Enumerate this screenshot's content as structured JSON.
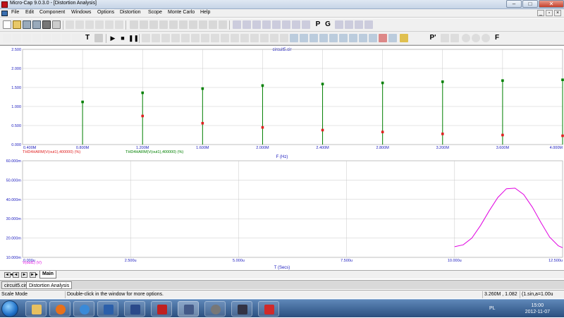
{
  "window": {
    "title": "Micro-Cap 9.0.3.0 - [Distortion Analysis]",
    "controls": {
      "minimize": "–",
      "maximize": "□",
      "close": "✕"
    }
  },
  "menubar": {
    "items": [
      "File",
      "Edit",
      "Component",
      "Windows",
      "Options",
      "Distortion",
      "Scope",
      "Monte Carlo",
      "Help"
    ],
    "mdi_controls": {
      "minimize": "_",
      "restore": "▫",
      "close": "×"
    }
  },
  "toolbar_text_buttons": {
    "text_tool": "T",
    "probe_p": "P",
    "probe_g": "G",
    "P_prime": "P'",
    "F_tool": "F"
  },
  "plot": {
    "circuit_title": "circuit5.cir",
    "top": {
      "ylim": [
        0,
        2.5
      ],
      "y_ticks": [
        "2.500",
        "2.000",
        "1.500",
        "1.000",
        "0.500",
        "0.000"
      ],
      "x_ticks": [
        "0.400M",
        "0.800M",
        "1.200M",
        "1.600M",
        "2.000M",
        "2.400M",
        "2.800M",
        "3.200M",
        "3.600M",
        "4.000M"
      ],
      "xlabel": "F (Hz)",
      "legend_red": "THD4HARM(V(out1),400000) (%)",
      "legend_green": "THD4HARM(V(out1),400000) (%)"
    },
    "bottom": {
      "ylim": [
        10,
        60
      ],
      "y_ticks": [
        "60.000m",
        "50.000m",
        "40.000m",
        "30.000m",
        "20.000m",
        "10.000m"
      ],
      "x_ticks": [
        "0.000u",
        "2.500u",
        "5.000u",
        "7.500u",
        "10.000u",
        "12.500u"
      ],
      "xlabel": "T (Secs)",
      "legend_magenta": "V(out1) (V)"
    }
  },
  "chart_data": [
    {
      "type": "scatter",
      "title": "circuit5.cir",
      "xlabel": "F (Hz)",
      "ylabel": "",
      "xlim": [
        0.4,
        4.0
      ],
      "ylim": [
        0,
        2.5
      ],
      "x_unit": "MHz",
      "grid": true,
      "series": [
        {
          "name": "THD4HARM(V(out1),400000) (%)",
          "color": "#008000",
          "x": [
            0.8,
            1.2,
            1.6,
            2.0,
            2.4,
            2.8,
            3.2,
            3.6,
            4.0
          ],
          "values": [
            1.12,
            1.36,
            1.47,
            1.55,
            1.59,
            1.62,
            1.65,
            1.68,
            1.7
          ]
        },
        {
          "name": "THD4HARM(V(out1),400000) (%)",
          "color": "#e02020",
          "x": [
            1.2,
            1.6,
            2.0,
            2.4,
            2.8,
            3.2,
            3.6,
            4.0
          ],
          "values": [
            0.75,
            0.56,
            0.45,
            0.38,
            0.33,
            0.28,
            0.25,
            0.23
          ]
        }
      ]
    },
    {
      "type": "line",
      "title": "",
      "xlabel": "T (Secs)",
      "ylabel": "",
      "xlim": [
        0,
        12.5
      ],
      "ylim": [
        10,
        60
      ],
      "x_unit": "us",
      "y_unit": "mV",
      "grid": true,
      "series": [
        {
          "name": "V(out1) (V)",
          "color": "#e000e0",
          "x": [
            10.0,
            10.2,
            10.4,
            10.6,
            10.8,
            11.0,
            11.2,
            11.4,
            11.6,
            11.8,
            12.0,
            12.2,
            12.4,
            12.5
          ],
          "values": [
            15.5,
            16.5,
            20.0,
            26.5,
            34.0,
            41.0,
            45.5,
            45.8,
            42.5,
            36.0,
            28.0,
            20.5,
            16.0,
            15.0
          ]
        }
      ]
    }
  ],
  "nav": {
    "buttons": [
      "◄◄",
      "◄",
      "►",
      "►►"
    ],
    "tab": "Main"
  },
  "doc_tabs": [
    "circuit5.cir",
    "Distortion Analysis"
  ],
  "status": {
    "mode": "Scale Mode",
    "hint": "Double-click in the window for more options.",
    "readout": "3.260M , 1.082",
    "info": "(1.sin,a=1.00u"
  },
  "taskbar": {
    "language": "PL",
    "time": "15:00",
    "date": "2012-11-07",
    "apps": [
      "explorer",
      "firefox",
      "chrome",
      "word",
      "save-disk",
      "acrobat-reader",
      "microcap",
      "media",
      "virtualbox",
      "pdf"
    ]
  },
  "colors": {
    "green": "#008000",
    "red": "#e02020",
    "magenta": "#e000e0",
    "axis_text_blue": "#2020c0",
    "grid": "#c8c8c8"
  }
}
